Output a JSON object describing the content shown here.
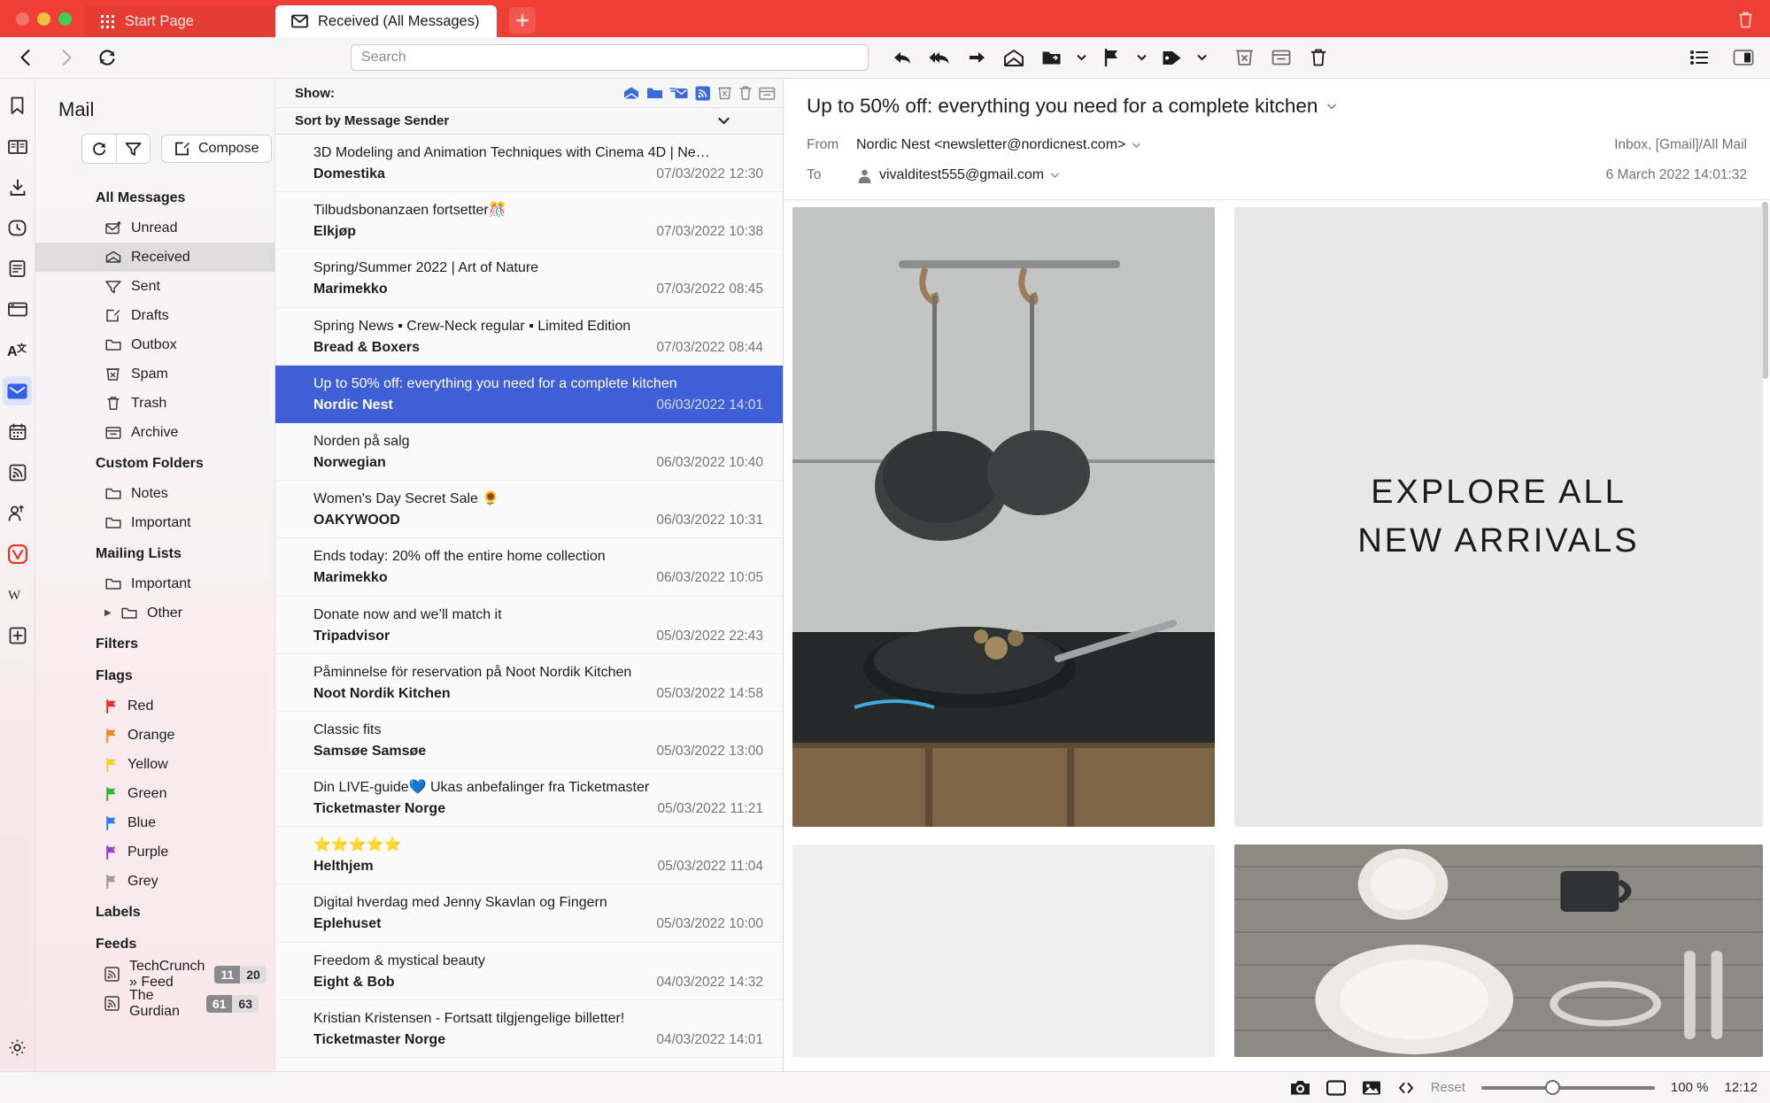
{
  "window": {
    "tabs": [
      {
        "label": "Start Page",
        "icon": "grid-icon",
        "active": false
      },
      {
        "label": "Received (All Messages)",
        "icon": "envelope-icon",
        "active": true
      }
    ],
    "new_tab_label": "+",
    "trash_icon": "trash-icon"
  },
  "navbar": {
    "back_icon": "back-arrow-icon",
    "forward_icon": "forward-arrow-icon",
    "reload_icon": "reload-icon",
    "search_placeholder": "Search",
    "search_value": "",
    "mail_tools": [
      {
        "name": "reply-button",
        "icon": "reply-icon"
      },
      {
        "name": "reply-all-button",
        "icon": "reply-all-icon"
      },
      {
        "name": "forward-button",
        "icon": "forward-icon"
      },
      {
        "name": "mark-unread-button",
        "icon": "open-envelope-icon"
      },
      {
        "name": "move-to-folder-button",
        "icon": "folder-move-icon"
      },
      {
        "name": "move-to-folder-dropdown",
        "icon": "chevron-down-icon"
      },
      {
        "name": "flag-button",
        "icon": "flag-icon"
      },
      {
        "name": "flag-dropdown",
        "icon": "chevron-down-icon"
      },
      {
        "name": "label-button",
        "icon": "tag-icon"
      },
      {
        "name": "label-dropdown",
        "icon": "chevron-down-icon"
      },
      {
        "name": "mark-spam-button",
        "icon": "spam-icon"
      },
      {
        "name": "archive-button",
        "icon": "archive-icon"
      },
      {
        "name": "delete-button",
        "icon": "trash-icon"
      }
    ],
    "right_tools": [
      {
        "name": "thread-view-button",
        "icon": "thread-list-icon"
      },
      {
        "name": "panel-toggle-button",
        "icon": "panel-toggle-icon"
      }
    ]
  },
  "panel_rail": [
    {
      "name": "bookmarks",
      "icon": "bookmark-icon",
      "active": false
    },
    {
      "name": "reading-list",
      "icon": "book-icon",
      "active": false
    },
    {
      "name": "downloads",
      "icon": "download-icon",
      "active": false
    },
    {
      "name": "history",
      "icon": "clock-icon",
      "active": false
    },
    {
      "name": "notes",
      "icon": "notes-icon",
      "active": false
    },
    {
      "name": "window-panel",
      "icon": "window-icon",
      "active": false
    },
    {
      "name": "translate",
      "icon": "translate-icon",
      "active": false
    },
    {
      "name": "mail",
      "icon": "mail-icon",
      "active": true
    },
    {
      "name": "calendar",
      "icon": "calendar-icon",
      "active": false
    },
    {
      "name": "feeds",
      "icon": "rss-icon",
      "active": false
    },
    {
      "name": "contacts",
      "icon": "contacts-icon",
      "active": false
    },
    {
      "name": "vivaldi",
      "icon": "vivaldi-icon",
      "active": false
    },
    {
      "name": "wikipedia",
      "icon": "wikipedia-icon",
      "active": false
    },
    {
      "name": "add-panel",
      "icon": "plus-box-icon",
      "active": false
    }
  ],
  "rail_settings_icon": "gear-icon",
  "sidebar": {
    "title": "Mail",
    "refresh_icon": "refresh-icon",
    "filter_icon": "filter-icon",
    "compose_label": "Compose",
    "compose_icon": "compose-icon",
    "sections": [
      {
        "heading": "All Messages",
        "items": [
          {
            "label": "Unread",
            "icon": "unread-envelope-icon",
            "selected": false
          },
          {
            "label": "Received",
            "icon": "received-envelope-icon",
            "selected": true
          },
          {
            "label": "Sent",
            "icon": "sent-icon",
            "selected": false
          },
          {
            "label": "Drafts",
            "icon": "drafts-icon",
            "selected": false
          },
          {
            "label": "Outbox",
            "icon": "folder-icon",
            "selected": false
          },
          {
            "label": "Spam",
            "icon": "spam-icon",
            "selected": false
          },
          {
            "label": "Trash",
            "icon": "trash-icon",
            "selected": false
          },
          {
            "label": "Archive",
            "icon": "archive-icon",
            "selected": false
          }
        ]
      },
      {
        "heading": "Custom Folders",
        "items": [
          {
            "label": "Notes",
            "icon": "folder-icon",
            "selected": false
          },
          {
            "label": "Important",
            "icon": "folder-icon",
            "selected": false
          }
        ]
      },
      {
        "heading": "Mailing Lists",
        "items": [
          {
            "label": "Important",
            "icon": "folder-icon",
            "selected": false
          },
          {
            "label": "Other",
            "icon": "folder-icon",
            "selected": false,
            "expandable": true,
            "caret": "▶"
          }
        ]
      },
      {
        "heading": "Filters",
        "items": []
      },
      {
        "heading": "Flags",
        "items": [
          {
            "label": "Red",
            "icon": "flag-icon",
            "color": "#ec2b2b"
          },
          {
            "label": "Orange",
            "icon": "flag-icon",
            "color": "#f08a21"
          },
          {
            "label": "Yellow",
            "icon": "flag-icon",
            "color": "#f2d128"
          },
          {
            "label": "Green",
            "icon": "flag-icon",
            "color": "#2db83d"
          },
          {
            "label": "Blue",
            "icon": "flag-icon",
            "color": "#2a7af0"
          },
          {
            "label": "Purple",
            "icon": "flag-icon",
            "color": "#9a3fd0"
          },
          {
            "label": "Grey",
            "icon": "flag-icon",
            "color": "#9a9a9e"
          }
        ]
      },
      {
        "heading": "Labels",
        "items": []
      },
      {
        "heading": "Feeds",
        "items": [
          {
            "label": "TechCrunch » Feed",
            "icon": "rss-icon",
            "badge_unread": "11",
            "badge_total": "20"
          },
          {
            "label": "The Gurdian",
            "icon": "rss-icon",
            "badge_unread": "61",
            "badge_total": "63"
          }
        ]
      }
    ]
  },
  "message_list": {
    "show_label": "Show:",
    "show_filters": [
      {
        "name": "show-received",
        "icon": "received-envelope-icon",
        "active": true
      },
      {
        "name": "show-folders",
        "icon": "folder-icon",
        "active": true
      },
      {
        "name": "show-sent",
        "icon": "sent-envelope-icon",
        "active": true
      },
      {
        "name": "show-feeds",
        "icon": "rss-icon",
        "active": true
      },
      {
        "name": "show-spam",
        "icon": "spam-icon",
        "active": false
      },
      {
        "name": "show-trash",
        "icon": "trash-icon",
        "active": false
      },
      {
        "name": "show-archive",
        "icon": "archive-icon",
        "active": false
      }
    ],
    "sort_label": "Sort by Message Sender",
    "sort_chevron_icon": "chevron-down-icon",
    "messages": [
      {
        "subject": "3D Modeling and Animation Techniques with Cinema 4D | Ne…",
        "sender": "Domestika",
        "date": "07/03/2022 12:30",
        "selected": false
      },
      {
        "subject": "Tilbudsbonanzaen fortsetter🎊",
        "sender": "Elkjøp",
        "date": "07/03/2022 10:38",
        "selected": false
      },
      {
        "subject": "Spring/Summer 2022 | Art of Nature",
        "sender": "Marimekko",
        "date": "07/03/2022 08:45",
        "selected": false
      },
      {
        "subject": "Spring News ▪ Crew-Neck regular ▪ Limited Edition",
        "sender": "Bread & Boxers",
        "date": "07/03/2022 08:44",
        "selected": false
      },
      {
        "subject": "Up to 50% off: everything you need for a complete kitchen",
        "sender": "Nordic Nest",
        "date": "06/03/2022 14:01",
        "selected": true
      },
      {
        "subject": "Norden på salg",
        "sender": "Norwegian",
        "date": "06/03/2022 10:40",
        "selected": false
      },
      {
        "subject": "Women's Day Secret Sale 🌻",
        "sender": "OAKYWOOD",
        "date": "06/03/2022 10:31",
        "selected": false
      },
      {
        "subject": "Ends today: 20% off the entire home collection",
        "sender": "Marimekko",
        "date": "06/03/2022 10:05",
        "selected": false
      },
      {
        "subject": "Donate now and we’ll match it",
        "sender": "Tripadvisor",
        "date": "05/03/2022 22:43",
        "selected": false
      },
      {
        "subject": "Påminnelse för reservation på Noot Nordik Kitchen",
        "sender": "Noot Nordik Kitchen",
        "date": "05/03/2022 14:58",
        "selected": false
      },
      {
        "subject": "Classic fits",
        "sender": "Samsøe Samsøe",
        "date": "05/03/2022 13:00",
        "selected": false
      },
      {
        "subject": "Din LIVE-guide💙 Ukas anbefalinger fra Ticketmaster",
        "sender": "Ticketmaster Norge",
        "date": "05/03/2022 11:21",
        "selected": false
      },
      {
        "subject": "⭐⭐⭐⭐⭐",
        "sender": "Helthjem",
        "date": "05/03/2022 11:04",
        "selected": false
      },
      {
        "subject": "Digital hverdag med Jenny Skavlan og Fingern",
        "sender": "Eplehuset",
        "date": "05/03/2022 10:00",
        "selected": false
      },
      {
        "subject": "Freedom & mystical beauty",
        "sender": "Eight & Bob",
        "date": "04/03/2022 14:32",
        "selected": false
      },
      {
        "subject": "Kristian Kristensen - Fortsatt tilgjengelige billetter!",
        "sender": "Ticketmaster Norge",
        "date": "04/03/2022 14:01",
        "selected": false
      }
    ]
  },
  "reader": {
    "subject": "Up to 50% off: everything you need for a complete kitchen",
    "subject_dropdown_icon": "chevron-down-icon",
    "from_label": "From",
    "from_value": "Nordic Nest <newsletter@nordicnest.com>",
    "from_dropdown_icon": "chevron-down-icon",
    "to_label": "To",
    "to_value": "vivalditest555@gmail.com",
    "to_avatar_icon": "avatar-icon",
    "to_dropdown_icon": "chevron-down-icon",
    "folder_path": "Inbox, [Gmail]/All Mail",
    "timestamp": "6 March 2022 14:01:32",
    "content": {
      "explore_line1": "EXPLORE ALL",
      "explore_line2": "NEW ARRIVALS"
    }
  },
  "statusbar": {
    "tools": [
      {
        "name": "capture-button",
        "icon": "camera-icon"
      },
      {
        "name": "tiling-button",
        "icon": "tile-icon"
      },
      {
        "name": "images-toggle-button",
        "icon": "image-icon"
      },
      {
        "name": "developer-tools-button",
        "icon": "code-icon"
      }
    ],
    "reset_label": "Reset",
    "zoom_percent": "100 %",
    "clock": "12:12"
  }
}
